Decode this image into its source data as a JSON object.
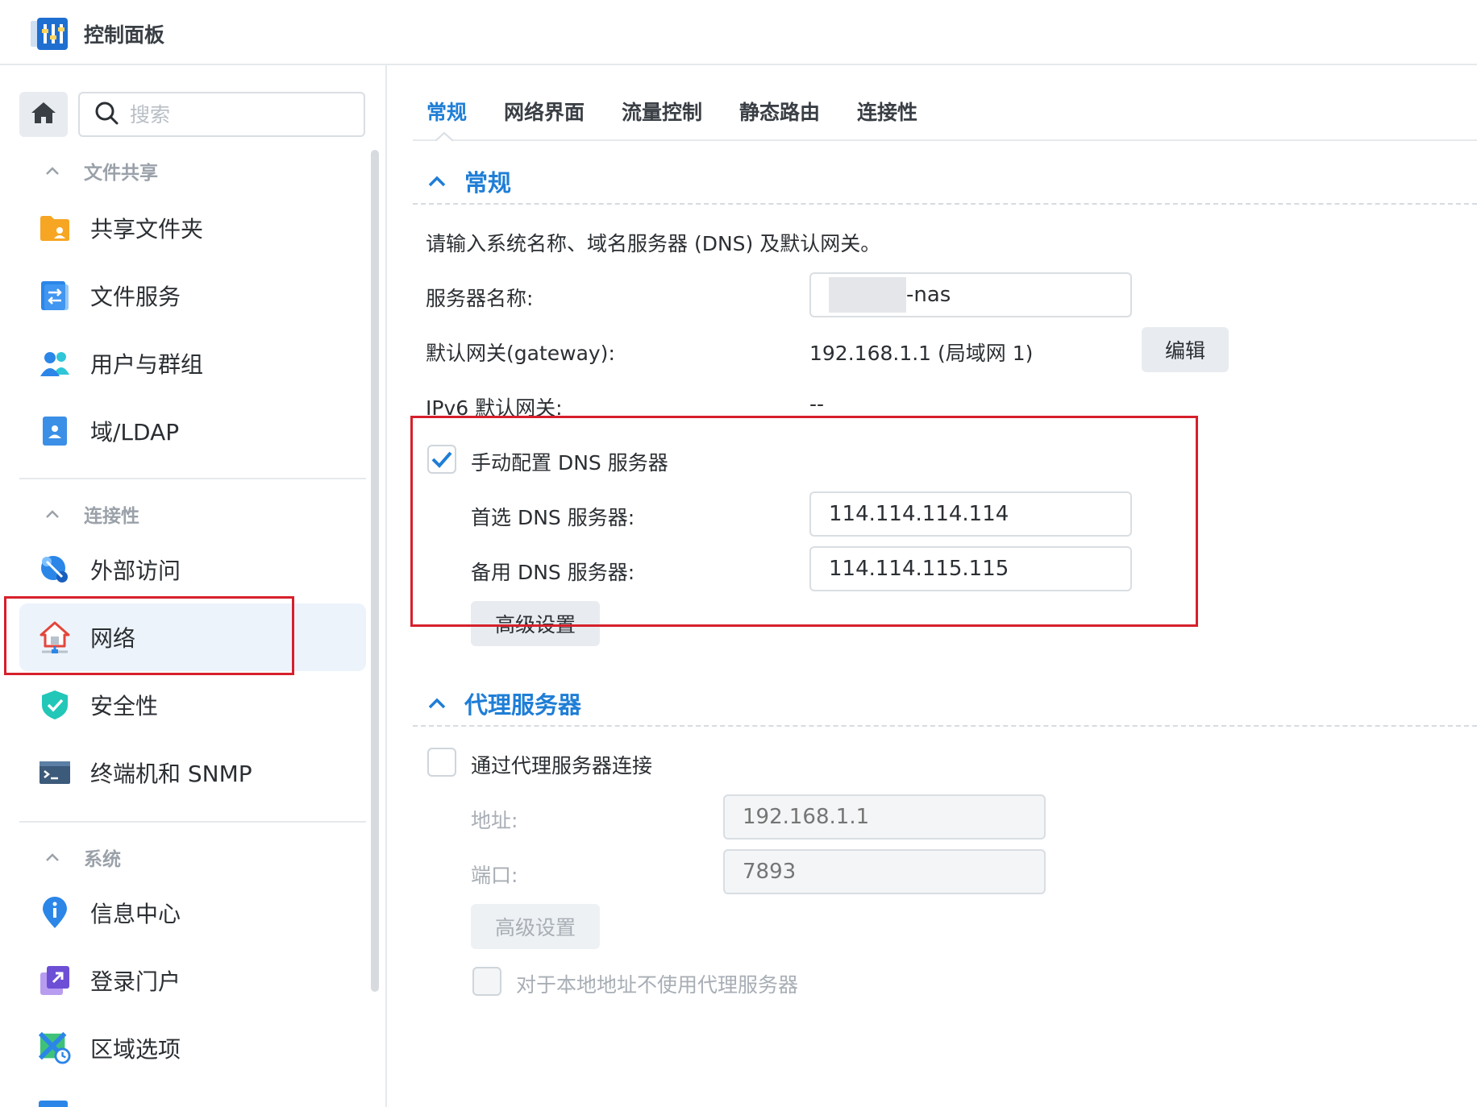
{
  "app": {
    "title": "控制面板"
  },
  "sidebar": {
    "search_placeholder": "搜索",
    "sections": [
      {
        "label": "文件共享"
      },
      {
        "label": "连接性"
      },
      {
        "label": "系统"
      }
    ],
    "items": [
      {
        "label": "共享文件夹",
        "icon": "folder-share-icon"
      },
      {
        "label": "文件服务",
        "icon": "file-services-icon"
      },
      {
        "label": "用户与群组",
        "icon": "users-icon"
      },
      {
        "label": "域/LDAP",
        "icon": "domain-ldap-icon"
      },
      {
        "label": "外部访问",
        "icon": "external-access-icon"
      },
      {
        "label": "网络",
        "icon": "network-house-icon",
        "active": true
      },
      {
        "label": "安全性",
        "icon": "shield-icon"
      },
      {
        "label": "终端机和 SNMP",
        "icon": "terminal-icon"
      },
      {
        "label": "信息中心",
        "icon": "info-pin-icon"
      },
      {
        "label": "登录门户",
        "icon": "login-portal-icon"
      },
      {
        "label": "区域选项",
        "icon": "regional-options-icon"
      }
    ]
  },
  "tabs": [
    {
      "label": "常规",
      "active": true
    },
    {
      "label": "网络界面"
    },
    {
      "label": "流量控制"
    },
    {
      "label": "静态路由"
    },
    {
      "label": "连接性"
    }
  ],
  "general": {
    "heading": "常规",
    "description": "请输入系统名称、域名服务器 (DNS) 及默认网关。",
    "server_name_label": "服务器名称:",
    "server_name_suffix": "-nas",
    "gateway_label": "默认网关(gateway):",
    "gateway_value": "192.168.1.1 (局域网 1)",
    "edit_button": "编辑",
    "ipv6_gateway_label": "IPv6 默认网关:",
    "ipv6_gateway_value": "--",
    "manual_dns_label": "手动配置 DNS 服务器",
    "manual_dns_checked": true,
    "preferred_dns_label": "首选 DNS 服务器:",
    "preferred_dns_value": "114.114.114.114",
    "alternate_dns_label": "备用 DNS 服务器:",
    "alternate_dns_value": "114.114.115.115",
    "advanced_button": "高级设置"
  },
  "proxy": {
    "heading": "代理服务器",
    "use_proxy_label": "通过代理服务器连接",
    "use_proxy_checked": false,
    "address_label": "地址:",
    "address_placeholder": "192.168.1.1",
    "port_label": "端口:",
    "port_placeholder": "7893",
    "advanced_button": "高级设置",
    "bypass_local_label": "对于本地地址不使用代理服务器",
    "bypass_local_checked": false
  },
  "colors": {
    "accent": "#1f7ed6",
    "highlight_box": "#d6202b",
    "active_item_bg": "#edf3fb"
  }
}
